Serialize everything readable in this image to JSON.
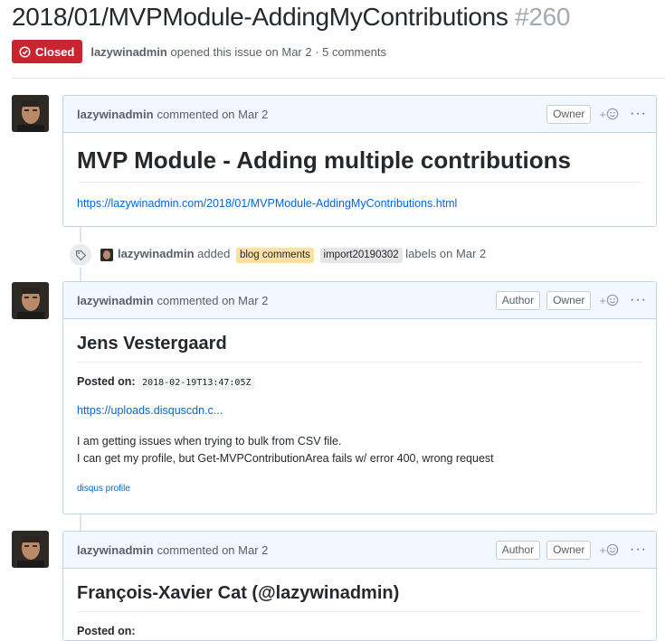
{
  "issue": {
    "title": "2018/01/MVPModule-AddingMyContributions",
    "number": "#260",
    "state": "Closed",
    "opener": "lazywinadmin",
    "opened_text": "opened this issue on Mar 2 · 5 comments"
  },
  "comments": [
    {
      "author": "lazywinadmin",
      "meta": "commented on Mar 2",
      "badges": [
        "Owner"
      ],
      "heading": "MVP Module - Adding multiple contributions",
      "link": "https://lazywinadmin.com/2018/01/MVPModule-AddingMyContributions.html"
    },
    {
      "author": "lazywinadmin",
      "meta": "commented on Mar 2",
      "badges": [
        "Author",
        "Owner"
      ],
      "heading": "Jens Vestergaard",
      "posted_label": "Posted on:",
      "posted_value": "2018-02-19T13:47:05Z",
      "link": "https://uploads.disquscdn.c...",
      "line1": "I am getting issues when trying to bulk from CSV file.",
      "line2": "I can get my profile, but Get-MVPContributionArea fails w/ error 400, wrong request",
      "profile_link": "disqus profile"
    },
    {
      "author": "lazywinadmin",
      "meta": "commented on Mar 2",
      "badges": [
        "Author",
        "Owner"
      ],
      "heading": "François-Xavier Cat (@lazywinadmin)",
      "posted_label": "Posted on:"
    }
  ],
  "label_event": {
    "actor": "lazywinadmin",
    "verb": "added",
    "labels": [
      {
        "name": "blog comments",
        "color": "#fbe0a3"
      },
      {
        "name": "import20190302",
        "color": "#e6e6e6"
      }
    ],
    "suffix": "labels on Mar 2"
  },
  "icons": {
    "state": "issue-closed-icon",
    "tag": "tag-icon",
    "reaction": "smiley-icon",
    "more": "kebab-horizontal-icon"
  },
  "colors": {
    "closed": "#cb2431",
    "link": "#0366d6",
    "header_bg": "#f1f8ff"
  }
}
